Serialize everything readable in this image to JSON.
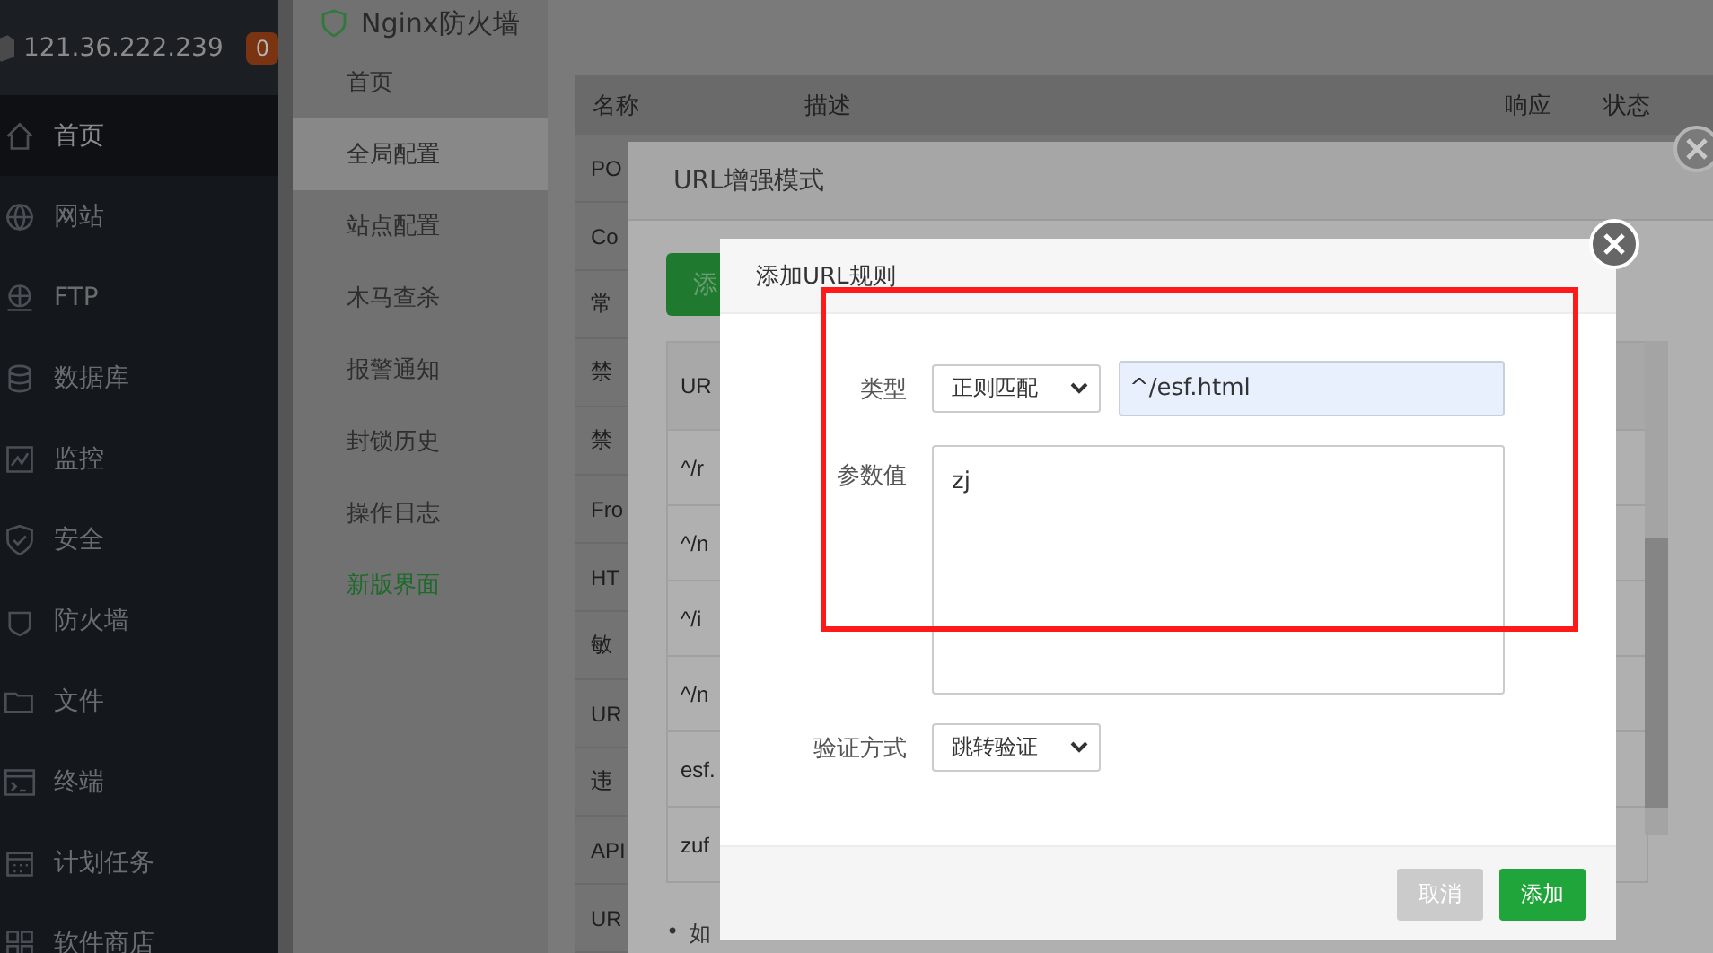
{
  "sidebar": {
    "host": "121.36.222.239",
    "badge": "0",
    "items": [
      {
        "label": "首页",
        "selected": true
      },
      {
        "label": "网站",
        "selected": false
      },
      {
        "label": "FTP",
        "selected": false
      },
      {
        "label": "数据库",
        "selected": false
      },
      {
        "label": "监控",
        "selected": false
      },
      {
        "label": "安全",
        "selected": false
      },
      {
        "label": "防火墙",
        "selected": false
      },
      {
        "label": "文件",
        "selected": false
      },
      {
        "label": "终端",
        "selected": false
      },
      {
        "label": "计划任务",
        "selected": false
      },
      {
        "label": "软件商店",
        "selected": false
      }
    ]
  },
  "plugin": {
    "title": "Nginx防火墙",
    "menu": [
      {
        "label": "首页",
        "selected": false,
        "kind": "page"
      },
      {
        "label": "全局配置",
        "selected": true,
        "kind": "page"
      },
      {
        "label": "站点配置",
        "selected": false,
        "kind": "page"
      },
      {
        "label": "木马查杀",
        "selected": false,
        "kind": "page"
      },
      {
        "label": "报警通知",
        "selected": false,
        "kind": "page"
      },
      {
        "label": "封锁历史",
        "selected": false,
        "kind": "page"
      },
      {
        "label": "操作日志",
        "selected": false,
        "kind": "page"
      },
      {
        "label": "新版界面",
        "selected": false,
        "kind": "link"
      }
    ]
  },
  "rules_table": {
    "columns": [
      "名称",
      "描述",
      "响应",
      "状态"
    ],
    "rows": [
      "PO",
      "Co",
      "常",
      "禁",
      "禁",
      "Fro",
      "HT",
      "敏",
      "UR",
      "违",
      "API",
      "UR"
    ]
  },
  "url_dialog": {
    "title": "URL增强模式",
    "add_button": "添",
    "table_header": "UR",
    "rows": [
      "^/r",
      "^/n",
      "^/i",
      "^/n",
      "esf.",
      "zuf"
    ],
    "note_bullet": "•",
    "note": "如"
  },
  "rule_dialog": {
    "title": "添加URL规则",
    "type_label": "类型",
    "type_value": "正则匹配",
    "pattern": "^/esf.html",
    "param_label": "参数值",
    "param_value": "zj",
    "verify_label": "验证方式",
    "verify_value": "跳转验证",
    "buttons": [
      {
        "label": "取消",
        "kind": "cancel"
      },
      {
        "label": "添加",
        "kind": "primary"
      }
    ]
  }
}
